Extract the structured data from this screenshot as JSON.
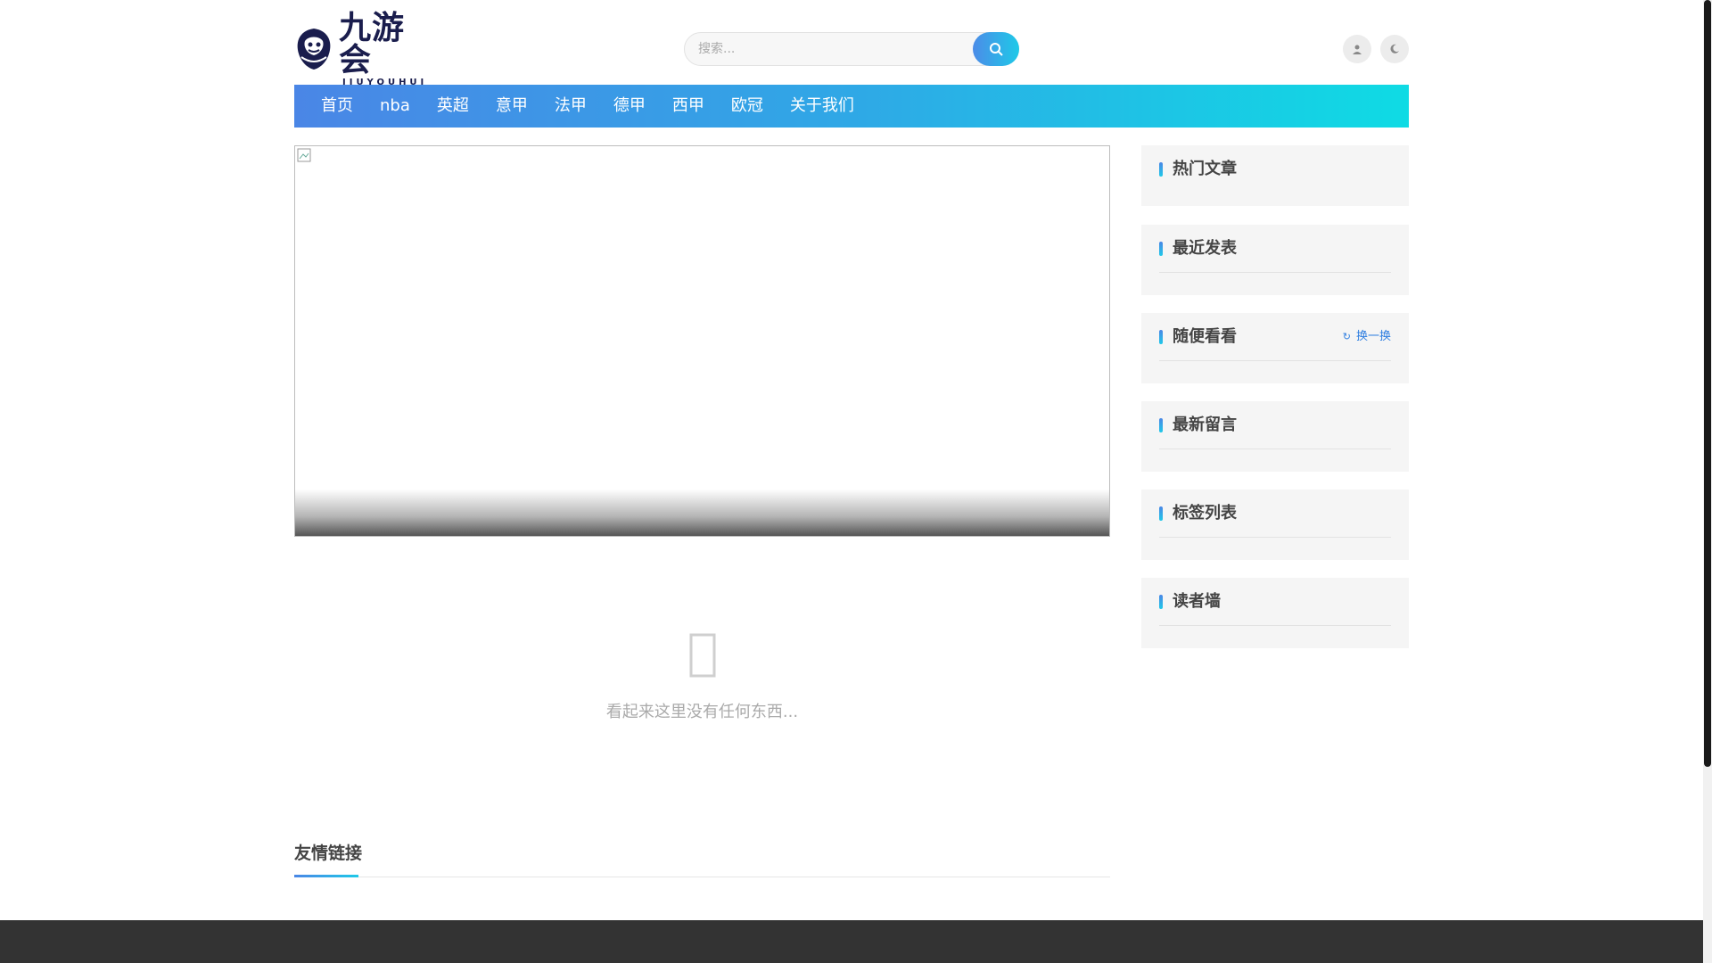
{
  "header": {
    "logo": {
      "cn": "九游会",
      "en": "JIUYOUHUI"
    },
    "search": {
      "placeholder": "搜索...",
      "button_icon": "search-icon"
    },
    "icons": [
      "user-icon",
      "moon-icon"
    ]
  },
  "nav": {
    "items": [
      "首页",
      "nba",
      "英超",
      "意甲",
      "法甲",
      "德甲",
      "西甲",
      "欧冠",
      "关于我们"
    ]
  },
  "main": {
    "empty_text": "看起来这里没有任何东西...",
    "empty_icon": "inbox-icon",
    "links_title": "友情链接"
  },
  "sidebar": {
    "widgets": [
      {
        "title": "热门文章"
      },
      {
        "title": "最近发表"
      },
      {
        "title": "随便看看",
        "action": "换一换"
      },
      {
        "title": "最新留言"
      },
      {
        "title": "标签列表"
      },
      {
        "title": "读者墙"
      }
    ]
  },
  "colors": {
    "accent_start": "#4a86e6",
    "accent_end": "#0fdbe4",
    "footer": "#333333"
  }
}
